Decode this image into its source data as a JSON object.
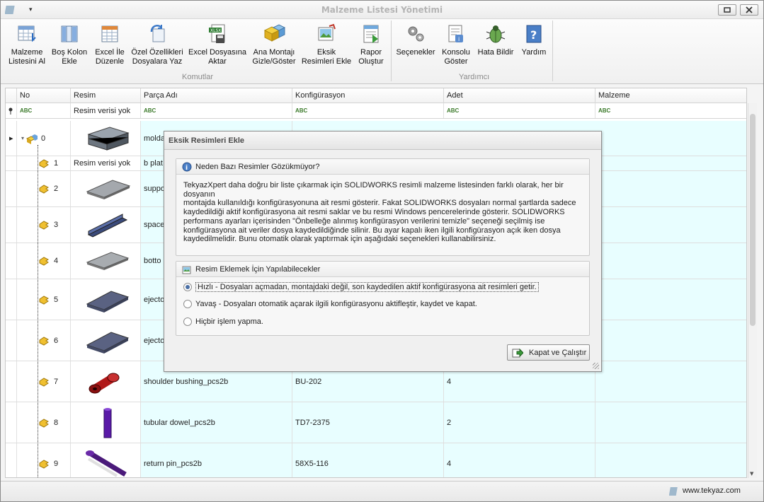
{
  "window": {
    "title": "Malzeme Listesi Yönetimi",
    "quick_access": "▾"
  },
  "ribbon": {
    "group1_label": "Komutlar",
    "group2_label": "Yardımcı",
    "buttons": [
      {
        "l1": "Malzeme",
        "l2": "Listesini Al"
      },
      {
        "l1": "Boş Kolon",
        "l2": "Ekle"
      },
      {
        "l1": "Excel İle",
        "l2": "Düzenle"
      },
      {
        "l1": "Özel Özellikleri",
        "l2": "Dosyalara Yaz"
      },
      {
        "l1": "Excel Dosyasına",
        "l2": "Aktar"
      },
      {
        "l1": "Ana Montajı",
        "l2": "Gizle/Göster"
      },
      {
        "l1": "Eksik",
        "l2": "Resimleri Ekle"
      },
      {
        "l1": "Rapor",
        "l2": "Oluştur"
      },
      {
        "l1": "Seçenekler",
        "l2": ""
      },
      {
        "l1": "Konsolu",
        "l2": "Göster"
      },
      {
        "l1": "Hata Bildir",
        "l2": ""
      },
      {
        "l1": "Yardım",
        "l2": ""
      }
    ]
  },
  "grid": {
    "columns": [
      "No",
      "Resim",
      "Parça Adı",
      "Konfigürasyon",
      "Adet",
      "Malzeme"
    ],
    "filter": {
      "abc": "ABC",
      "resim": "Resim verisi yok"
    },
    "rows": [
      {
        "no": "0",
        "resim": "",
        "name": "molda",
        "conf": "",
        "qty": ""
      },
      {
        "no": "1",
        "resim": "Resim verisi yok",
        "name": "b plat",
        "conf": "",
        "qty": ""
      },
      {
        "no": "2",
        "resim": "",
        "name": "suppo",
        "conf": "",
        "qty": ""
      },
      {
        "no": "3",
        "resim": "",
        "name": "space",
        "conf": "",
        "qty": ""
      },
      {
        "no": "4",
        "resim": "",
        "name": "botto",
        "conf": "",
        "qty": ""
      },
      {
        "no": "5",
        "resim": "",
        "name": "ejecto",
        "conf": "",
        "qty": ""
      },
      {
        "no": "6",
        "resim": "",
        "name": "ejecto",
        "conf": "",
        "qty": ""
      },
      {
        "no": "7",
        "resim": "",
        "name": "shoulder bushing_pcs2b",
        "conf": "BU-202",
        "qty": "4"
      },
      {
        "no": "8",
        "resim": "",
        "name": "tubular dowel_pcs2b",
        "conf": "TD7-2375",
        "qty": "2"
      },
      {
        "no": "9",
        "resim": "",
        "name": "return pin_pcs2b",
        "conf": "58X5-116",
        "qty": "4"
      }
    ]
  },
  "dialog": {
    "title": "Eksik Resimleri Ekle",
    "info_header": "Neden Bazı Resimler Gözükmüyor?",
    "info_lines": [
      "TekyazXpert daha doğru bir liste çıkarmak için SOLIDWORKS resimli malzeme listesinden farklı olarak, her bir dosyanın",
      "montajda kullanıldığı konfigürasyonuna ait resmi gösterir. Fakat SOLIDWORKS dosyaları normal şartlarda sadece",
      "kaydedildiği aktif konfigürasyona ait resmi saklar ve bu resmi Windows pencerelerinde gösterir. SOLIDWORKS",
      "performans ayarları içerisinden \"Önbelleğe alınmış konfigürasyon verilerini temizle\" seçeneği seçilmiş ise",
      "konfigürasyona ait veriler dosya kaydedildiğinde silinir. Bu ayar kapalı iken ilgili konfigürasyon açık iken dosya",
      "kaydedilmelidir. Bunu otomatik olarak yaptırmak için aşağıdaki seçenekleri kullanabilirsiniz."
    ],
    "options_header": "Resim Eklemek İçin Yapılabilecekler",
    "options": [
      {
        "label": "Hızlı - Dosyaları açmadan, montajdaki değil, son kaydedilen aktif konfigürasyona ait resimleri getir.",
        "selected": true
      },
      {
        "label": "Yavaş - Dosyaları otomatik açarak ilgili konfigürasyonu aktifleştir, kaydet ve kapat.",
        "selected": false
      },
      {
        "label": "Hiçbir işlem yapma.",
        "selected": false
      }
    ],
    "run_button": "Kapat ve Çalıştır"
  },
  "status": {
    "website": "www.tekyaz.com"
  }
}
